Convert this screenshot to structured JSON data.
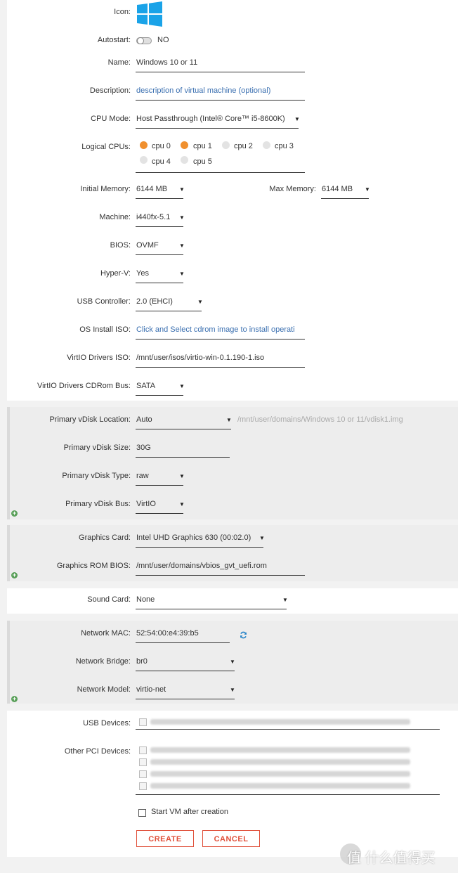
{
  "form": {
    "icon_label": "Icon:",
    "autostart": {
      "label": "Autostart:",
      "value": "NO"
    },
    "name": {
      "label": "Name:",
      "value": "Windows 10 or 11"
    },
    "description": {
      "label": "Description:",
      "placeholder": "description of virtual machine (optional)"
    },
    "cpu_mode": {
      "label": "CPU Mode:",
      "value": "Host Passthrough (Intel® Core™ i5-8600K)"
    },
    "logical_cpus": {
      "label": "Logical CPUs:",
      "cpus": [
        {
          "label": "cpu 0",
          "selected": true
        },
        {
          "label": "cpu 1",
          "selected": true
        },
        {
          "label": "cpu 2",
          "selected": false
        },
        {
          "label": "cpu 3",
          "selected": false
        },
        {
          "label": "cpu 4",
          "selected": false
        },
        {
          "label": "cpu 5",
          "selected": false
        }
      ]
    },
    "initial_memory": {
      "label": "Initial Memory:",
      "value": "6144 MB"
    },
    "max_memory": {
      "label": "Max Memory:",
      "value": "6144 MB"
    },
    "machine": {
      "label": "Machine:",
      "value": "i440fx-5.1"
    },
    "bios": {
      "label": "BIOS:",
      "value": "OVMF"
    },
    "hyperv": {
      "label": "Hyper-V:",
      "value": "Yes"
    },
    "usb_controller": {
      "label": "USB Controller:",
      "value": "2.0 (EHCI)"
    },
    "os_iso": {
      "label": "OS Install ISO:",
      "placeholder": "Click and Select cdrom image to install operati"
    },
    "virtio_iso": {
      "label": "VirtIO Drivers ISO:",
      "value": "/mnt/user/isos/virtio-win-0.1.190-1.iso"
    },
    "virtio_bus": {
      "label": "VirtIO Drivers CDRom Bus:",
      "value": "SATA"
    }
  },
  "vdisk": {
    "location": {
      "label": "Primary vDisk Location:",
      "value": "Auto",
      "path": "/mnt/user/domains/Windows 10 or 11/vdisk1.img"
    },
    "size": {
      "label": "Primary vDisk Size:",
      "value": "30G"
    },
    "type": {
      "label": "Primary vDisk Type:",
      "value": "raw"
    },
    "bus": {
      "label": "Primary vDisk Bus:",
      "value": "VirtIO"
    }
  },
  "graphics": {
    "card": {
      "label": "Graphics Card:",
      "value": "Intel UHD Graphics 630 (00:02.0)"
    },
    "rom": {
      "label": "Graphics ROM BIOS:",
      "value": "/mnt/user/domains/vbios_gvt_uefi.rom"
    }
  },
  "sound": {
    "label": "Sound Card:",
    "value": "None"
  },
  "network": {
    "mac": {
      "label": "Network MAC:",
      "value": "52:54:00:e4:39:b5"
    },
    "bridge": {
      "label": "Network Bridge:",
      "value": "br0"
    },
    "model": {
      "label": "Network Model:",
      "value": "virtio-net"
    }
  },
  "devices": {
    "usb_label": "USB Devices:",
    "pci_label": "Other PCI Devices:"
  },
  "start_after": {
    "label": "Start VM after creation",
    "checked": false
  },
  "buttons": {
    "create": "CREATE",
    "cancel": "CANCEL"
  },
  "watermark": "值 什么值得买",
  "colors": {
    "accent": "#f0902f",
    "link": "#3a6fb0",
    "button": "#e0503a",
    "windows_blue": "#1aa3e8"
  }
}
